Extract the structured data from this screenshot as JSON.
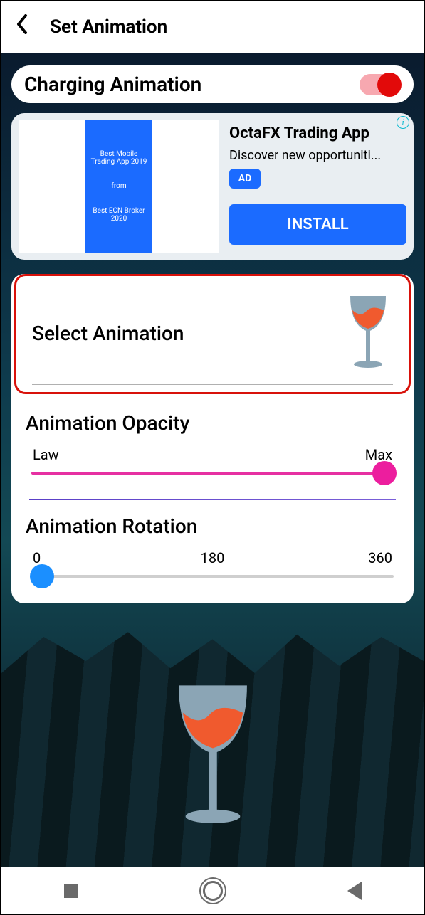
{
  "header": {
    "title": "Set Animation"
  },
  "toggle": {
    "label": "Charging Animation",
    "on": true
  },
  "ad": {
    "title": "OctaFX Trading App",
    "desc": "Discover new opportuniti...",
    "badge": "AD",
    "button": "INSTALL",
    "banner_lines": [
      "Best Mobile Trading App 2019",
      "from",
      "Best ECN Broker 2020"
    ]
  },
  "select": {
    "label": "Select Animation"
  },
  "opacity": {
    "title": "Animation Opacity",
    "low": "Law",
    "high": "Max",
    "value_pct": 100
  },
  "rotation": {
    "title": "Animation Rotation",
    "labels": [
      "0",
      "180",
      "360"
    ],
    "value_pct": 0
  }
}
